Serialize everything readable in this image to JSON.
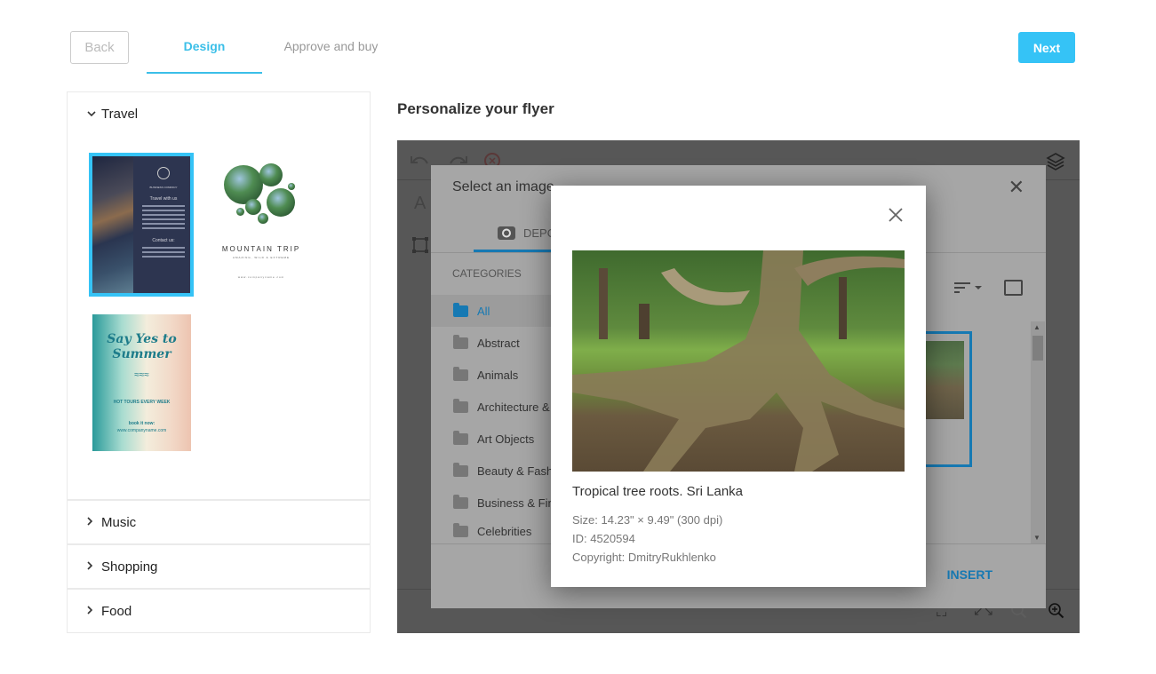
{
  "header": {
    "back_label": "Back",
    "steps": [
      {
        "label": "Design",
        "active": true
      },
      {
        "label": "Approve and buy",
        "active": false
      }
    ],
    "next_label": "Next"
  },
  "sidebar": {
    "categories": [
      {
        "label": "Travel",
        "expanded": true,
        "icon": "chevron-down-icon"
      },
      {
        "label": "Music",
        "expanded": false,
        "icon": "chevron-right-icon"
      },
      {
        "label": "Shopping",
        "expanded": false,
        "icon": "chevron-right-icon"
      },
      {
        "label": "Food",
        "expanded": false,
        "icon": "chevron-right-icon"
      }
    ],
    "templates": [
      {
        "name": "Travel with us",
        "company": "BUSINESS COMPANY",
        "contact": "Contact us:",
        "selected": true
      },
      {
        "name": "MOUNTAIN TRIP",
        "subtitle": "AMAZING, WILD & EXTREME",
        "url": "www.companyname.com",
        "selected": false
      },
      {
        "name": "Say Yes to Summer",
        "tagline": "HOT TOURS EVERY WEEK",
        "cta": "book it now:",
        "url": "www.companyname.com",
        "selected": false
      }
    ]
  },
  "main": {
    "title": "Personalize your flyer"
  },
  "select_dialog": {
    "title": "Select an image",
    "tab_label": "DEPO",
    "categories_title": "CATEGORIES",
    "categories": [
      {
        "label": "All",
        "active": true
      },
      {
        "label": "Abstract"
      },
      {
        "label": "Animals"
      },
      {
        "label": "Architecture &"
      },
      {
        "label": "Art Objects"
      },
      {
        "label": "Beauty & Fash"
      },
      {
        "label": "Business & Fin"
      },
      {
        "label": "Celebrities"
      }
    ],
    "insert_label": "INSERT"
  },
  "preview": {
    "title": "Tropical tree roots. Sri Lanka",
    "size": "Size: 14.23\" × 9.49\" (300 dpi)",
    "id": "ID: 4520594",
    "copyright": "Copyright: DmitryRukhlenko"
  },
  "colors": {
    "accent": "#35c3f6",
    "dialog_accent": "#1679b3",
    "editor_bg": "#575757"
  },
  "icons": {
    "close": "✕",
    "chevron_down": "⌄",
    "chevron_right": "›",
    "layers": "layers-icon",
    "zoom_in": "zoom-in-icon"
  }
}
